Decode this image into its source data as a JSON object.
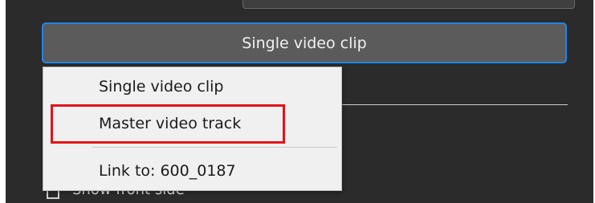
{
  "dropdown": {
    "selected_value": "Single video clip"
  },
  "menu": {
    "items": [
      {
        "label": "Single video clip"
      },
      {
        "label": "Master video track"
      },
      {
        "label": "Link to: 600_0187"
      }
    ]
  },
  "background": {
    "checkbox_label": "Show front side"
  },
  "colors": {
    "panel_background": "#2b2b2b",
    "dropdown_background": "#5b5b5b",
    "focus_border": "#1f86e8",
    "menu_background": "#f0f0f0",
    "annotation_red": "#e4111b"
  }
}
